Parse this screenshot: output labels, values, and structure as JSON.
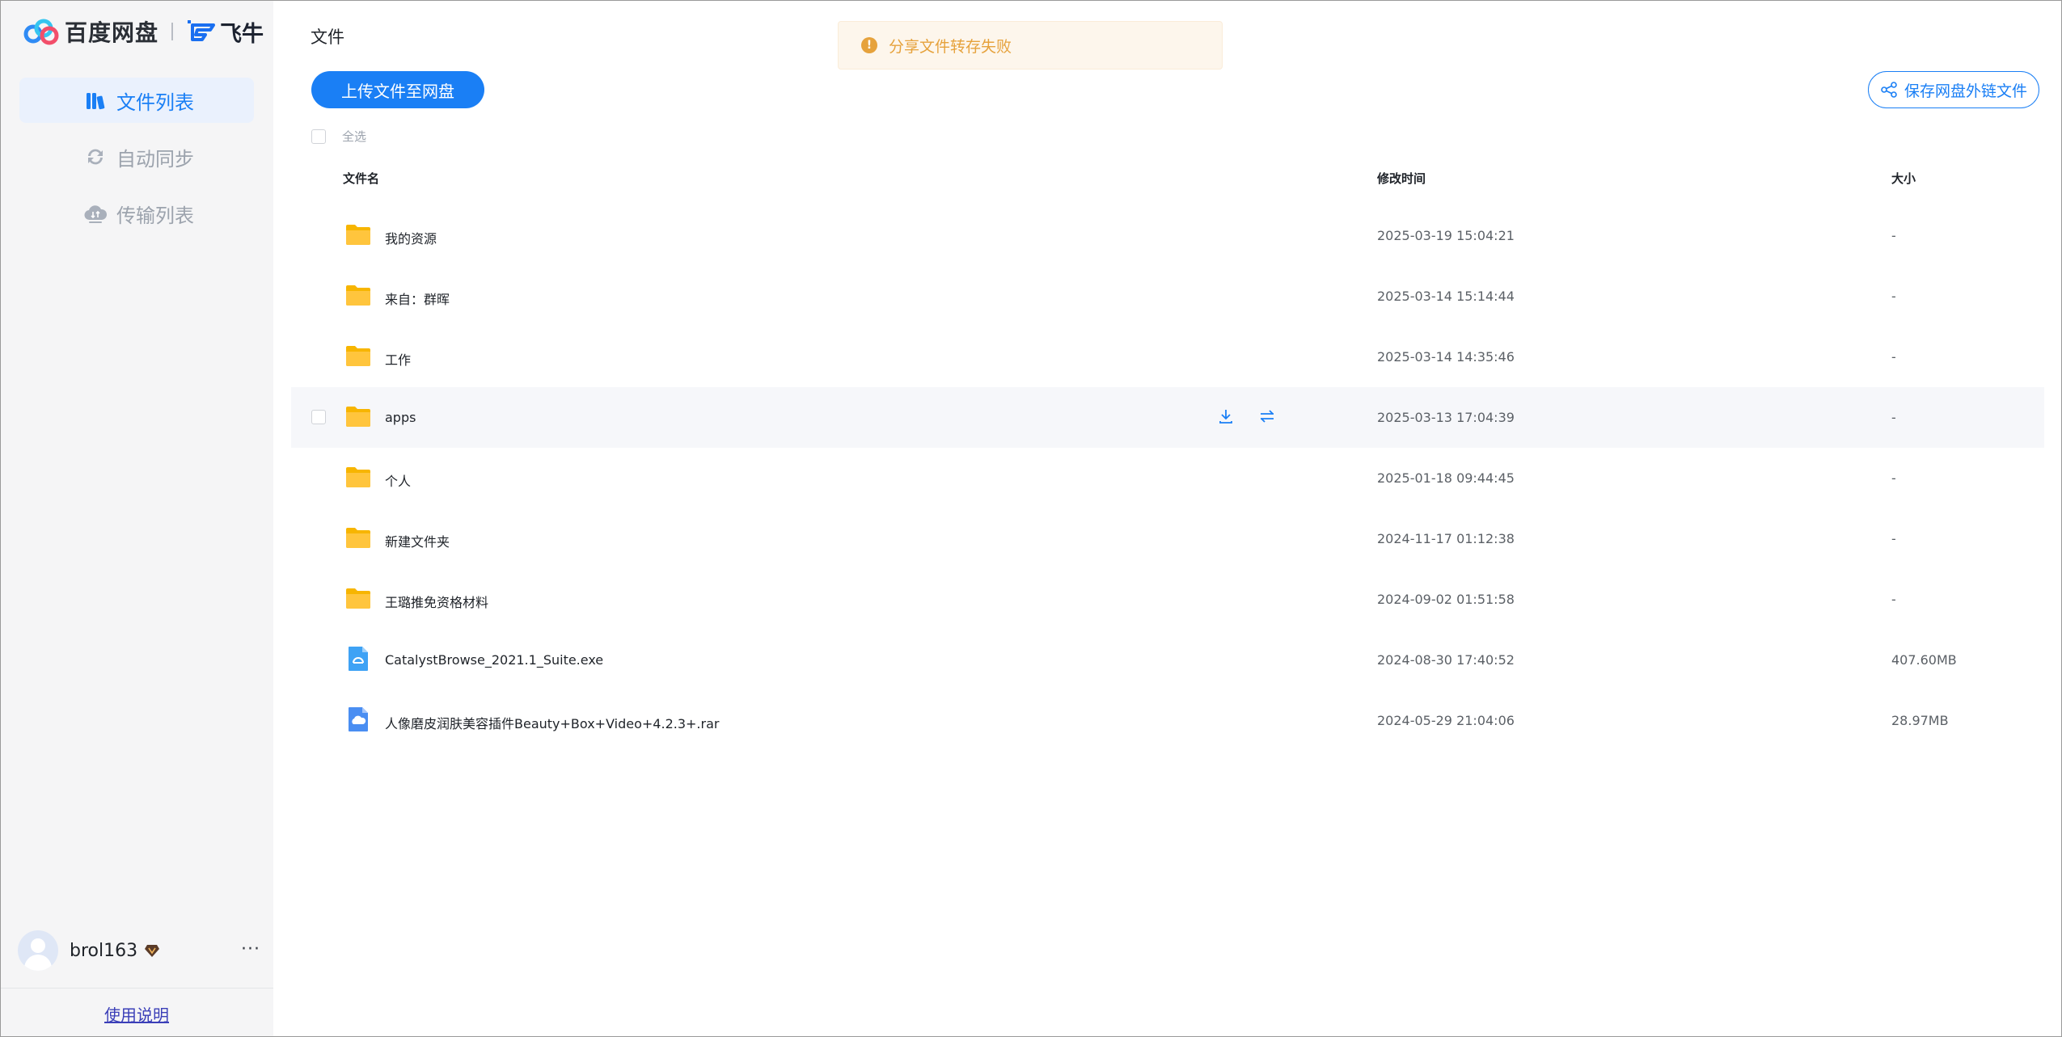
{
  "brand": {
    "name": "百度网盘",
    "partner": "飞牛"
  },
  "nav": [
    {
      "label": "文件列表",
      "active": true,
      "icon": "file-list-icon"
    },
    {
      "label": "自动同步",
      "active": false,
      "icon": "sync-icon"
    },
    {
      "label": "传输列表",
      "active": false,
      "icon": "transfer-cloud-icon"
    }
  ],
  "user": {
    "name": "brol163",
    "more": "···"
  },
  "help": {
    "label": "使用说明"
  },
  "main": {
    "title": "文件",
    "toast": {
      "text": "分享文件转存失败",
      "icon": "!"
    },
    "upload_button": "上传文件至网盘",
    "save_link_button": "保存网盘外链文件",
    "select_all": "全选",
    "columns": {
      "name": "文件名",
      "time": "修改时间",
      "size": "大小"
    }
  },
  "files": [
    {
      "name": "我的资源",
      "time": "2025-03-19 15:04:21",
      "size": "-",
      "type": "folder"
    },
    {
      "name": "来自：群晖",
      "time": "2025-03-14 15:14:44",
      "size": "-",
      "type": "folder"
    },
    {
      "name": "工作",
      "time": "2025-03-14 14:35:46",
      "size": "-",
      "type": "folder"
    },
    {
      "name": "apps",
      "time": "2025-03-13 17:04:39",
      "size": "-",
      "type": "folder",
      "hover": true
    },
    {
      "name": "个人",
      "time": "2025-01-18 09:44:45",
      "size": "-",
      "type": "folder"
    },
    {
      "name": "新建文件夹",
      "time": "2024-11-17 01:12:38",
      "size": "-",
      "type": "folder"
    },
    {
      "name": "王璐推免资格材料",
      "time": "2024-09-02 01:51:58",
      "size": "-",
      "type": "folder"
    },
    {
      "name": "CatalystBrowse_2021.1_Suite.exe",
      "time": "2024-08-30 17:40:52",
      "size": "407.60MB",
      "type": "exe"
    },
    {
      "name": "人像磨皮润肤美容插件Beauty+Box+Video+4.2.3+.rar",
      "time": "2024-05-29 21:04:06",
      "size": "28.97MB",
      "type": "archive"
    }
  ],
  "colors": {
    "accent": "#1a7ff5",
    "warning": "#e6a23c",
    "folder": "#ffc53d"
  }
}
